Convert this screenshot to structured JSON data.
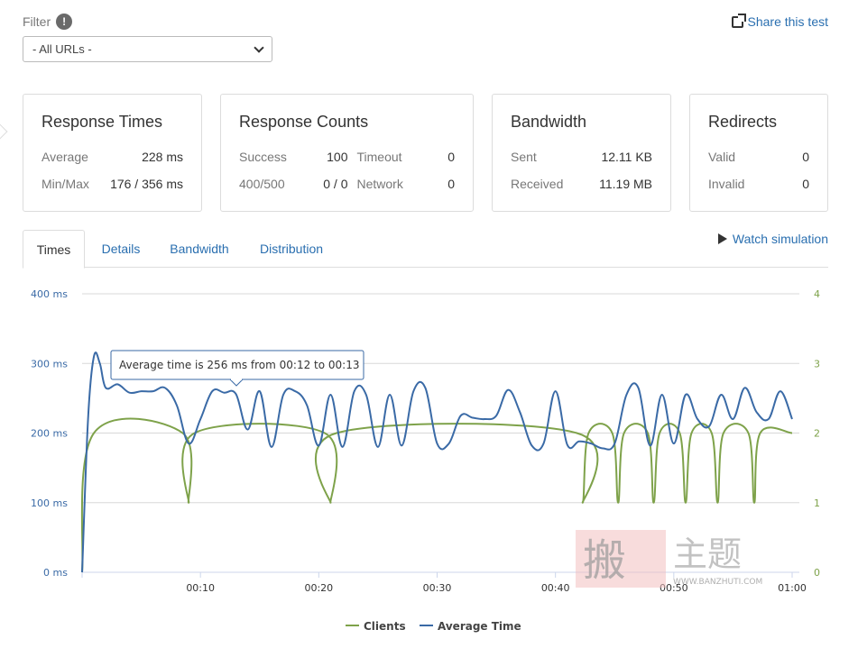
{
  "filter": {
    "label": "Filter",
    "info_icon": "!",
    "selected": "- All URLs -"
  },
  "share": {
    "label": "Share this test"
  },
  "cards": {
    "response_times": {
      "title": "Response Times",
      "avg_label": "Average",
      "avg_value": "228 ms",
      "minmax_label": "Min/Max",
      "minmax_value": "176 / 356 ms"
    },
    "response_counts": {
      "title": "Response Counts",
      "success_label": "Success",
      "success_value": "100",
      "timeout_label": "Timeout",
      "timeout_value": "0",
      "err_label": "400/500",
      "err_value": "0 / 0",
      "network_label": "Network",
      "network_value": "0"
    },
    "bandwidth": {
      "title": "Bandwidth",
      "sent_label": "Sent",
      "sent_value": "12.11 KB",
      "recv_label": "Received",
      "recv_value": "11.19 MB"
    },
    "redirects": {
      "title": "Redirects",
      "valid_label": "Valid",
      "valid_value": "0",
      "invalid_label": "Invalid",
      "invalid_value": "0"
    }
  },
  "tabs": [
    "Times",
    "Details",
    "Bandwidth",
    "Distribution"
  ],
  "watch_simulation": "Watch simulation",
  "tooltip": "Average time is 256 ms from 00:12 to 00:13",
  "watermark": {
    "cn": "搬 主题",
    "url": "WWW.BANZHUTI.COM"
  },
  "colors": {
    "clients": "#7ea24a",
    "average_time": "#3a6aa6",
    "link": "#2a6fb0"
  },
  "chart_data": {
    "type": "line",
    "x_ticks": [
      "00:10",
      "00:20",
      "00:30",
      "00:40",
      "00:50",
      "01:00"
    ],
    "y_left_ticks": [
      "0 ms",
      "100 ms",
      "200 ms",
      "300 ms",
      "400 ms"
    ],
    "y_right_ticks": [
      "0",
      "1",
      "2",
      "3",
      "4"
    ],
    "ylim_left": [
      0,
      400
    ],
    "ylim_right": [
      0,
      4
    ],
    "xlim_seconds": [
      0,
      60
    ],
    "grid": true,
    "legend_position": "bottom-center",
    "series": [
      {
        "name": "Clients",
        "axis": "right",
        "x": [
          0,
          1,
          8.5,
          9,
          9.5,
          20.5,
          21,
          21.5,
          41.8,
          42.3,
          42.8,
          44.8,
          45.3,
          45.8,
          47.8,
          48.3,
          48.8,
          50.5,
          51,
          51.5,
          53.2,
          53.7,
          54.2,
          56.3,
          56.8,
          57.3,
          60
        ],
        "values": [
          0,
          2,
          2,
          1,
          2,
          2,
          1,
          2,
          2,
          1,
          2,
          2,
          1,
          2,
          2,
          1,
          2,
          2,
          1,
          2,
          2,
          1,
          2,
          2,
          1,
          2,
          2
        ]
      },
      {
        "name": "Average Time",
        "axis": "left",
        "x": [
          0,
          0.5,
          1,
          1.5,
          2,
          3,
          4,
          5,
          6,
          7,
          8,
          9,
          10,
          11,
          12,
          13,
          14,
          15,
          16,
          17,
          18,
          19,
          20,
          21,
          22,
          23,
          24,
          25,
          26,
          27,
          28,
          29,
          30,
          31,
          32,
          33,
          34,
          35,
          36,
          37,
          38,
          39,
          40,
          41,
          42,
          43,
          44,
          45,
          46,
          47,
          48,
          49,
          50,
          51,
          52,
          53,
          54,
          55,
          56,
          57,
          58,
          59,
          60
        ],
        "values": [
          0,
          220,
          310,
          300,
          265,
          270,
          258,
          260,
          260,
          265,
          240,
          185,
          220,
          260,
          258,
          256,
          205,
          260,
          180,
          255,
          260,
          240,
          182,
          255,
          180,
          260,
          255,
          180,
          255,
          182,
          260,
          265,
          185,
          185,
          225,
          222,
          220,
          225,
          262,
          230,
          182,
          185,
          260,
          183,
          188,
          185,
          178,
          185,
          255,
          265,
          182,
          255,
          185,
          255,
          220,
          210,
          255,
          220,
          265,
          230,
          220,
          260,
          220
        ]
      }
    ]
  }
}
